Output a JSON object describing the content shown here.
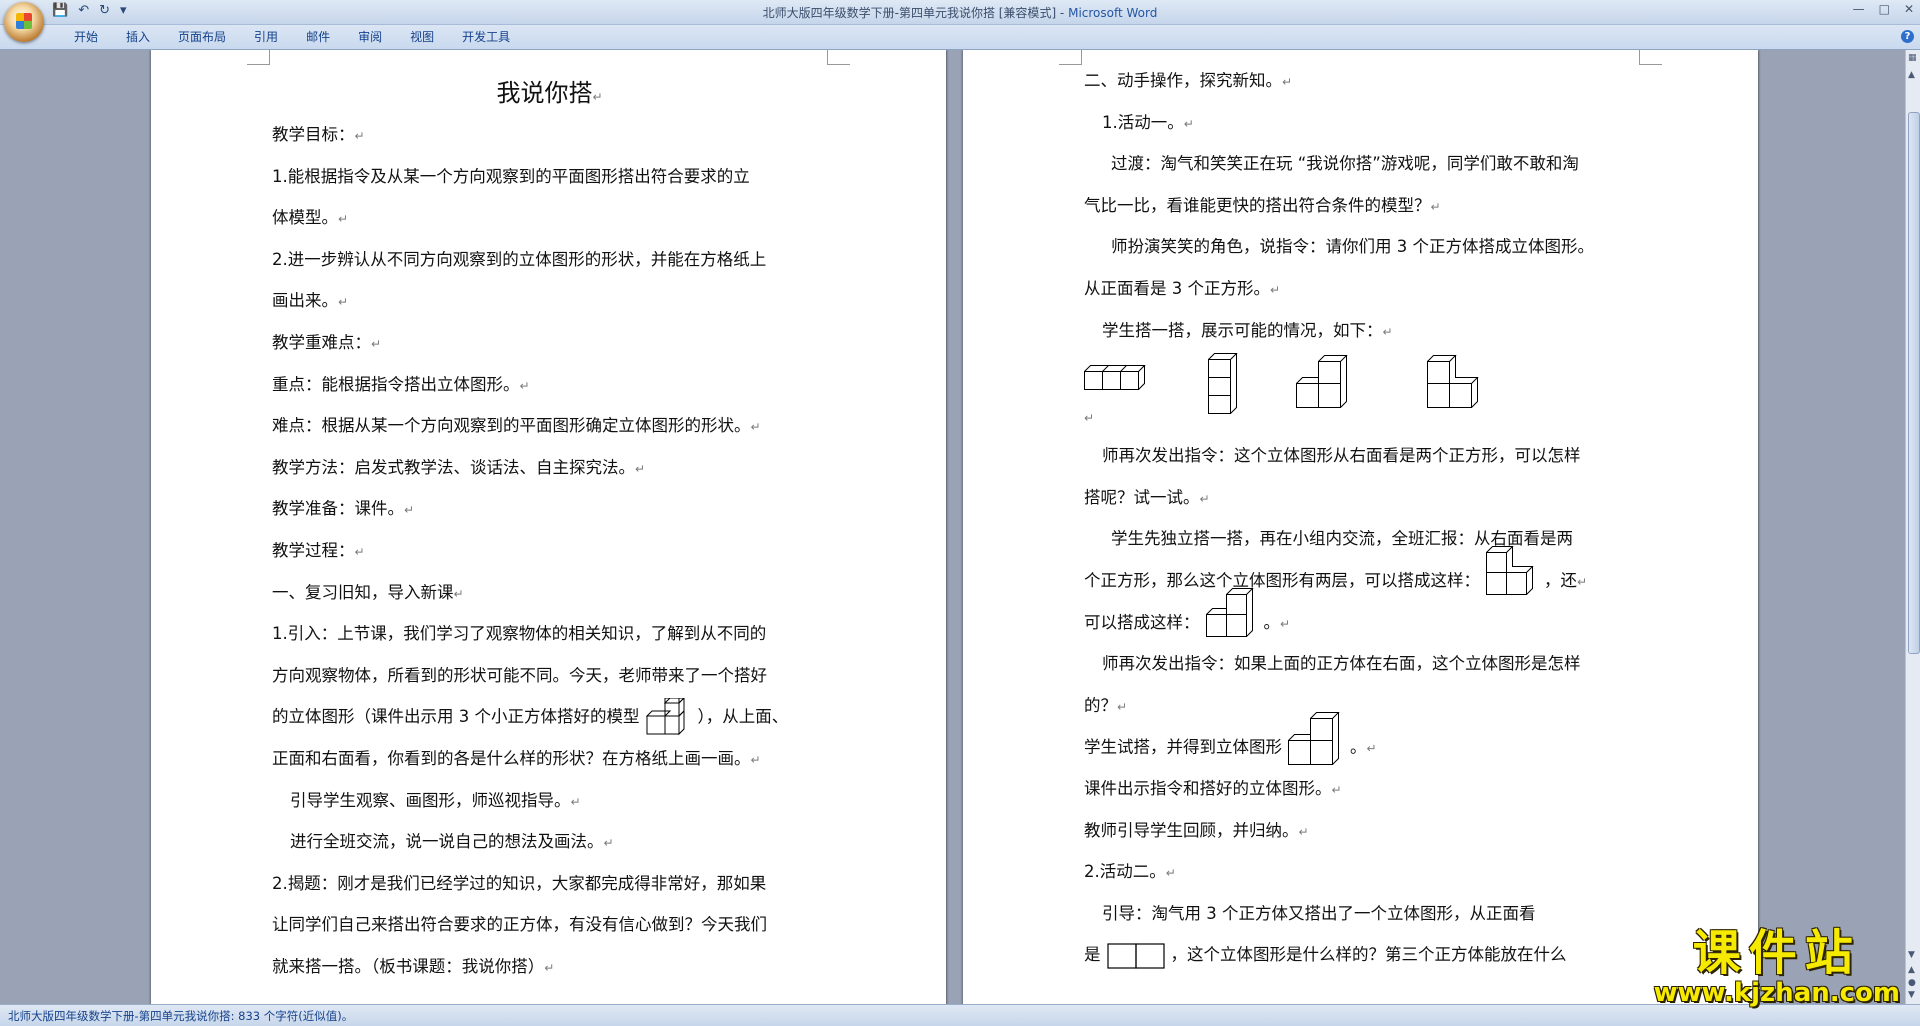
{
  "titlebar": {
    "doc_title": "北师大版四年级数学下册-第四单元我说你搭 [兼容模式] - ",
    "app_name": "Microsoft Word",
    "qat": {
      "save": "💾",
      "undo": "↶",
      "redo": "↻",
      "more": "▾"
    },
    "controls": {
      "minimize": "—",
      "maximize": "□",
      "close": "✕"
    }
  },
  "ribbon": {
    "tabs": [
      "开始",
      "插入",
      "页面布局",
      "引用",
      "邮件",
      "审阅",
      "视图",
      "开发工具"
    ],
    "help": "?"
  },
  "left_page": {
    "title": "我说你搭",
    "lines": [
      "教学目标：",
      "1.能根据指令及从某一个方向观察到的平面图形搭出符合要求的立",
      "体模型。",
      "2.进一步辨认从不同方向观察到的立体图形的形状，并能在方格纸上",
      "画出来。",
      "教学重难点：",
      "重点：能根据指令搭出立体图形。",
      "难点：根据从某一个方向观察到的平面图形确定立体图形的形状。",
      "教学方法：启发式教学法、谈话法、自主探究法。",
      "教学准备：课件。",
      "教学过程：",
      "一、复习旧知，导入新课",
      "1.引入：上节课，我们学习了观察物体的相关知识，了解到从不同的",
      "方向观察物体，所看到的形状可能不同。今天，老师带来了一个搭好"
    ],
    "model_line_a": "的立体图形（课件出示用 3 个小正方体搭好的模型",
    "model_line_b": "），从上面、",
    "lines2": [
      "正面和右面看，你看到的各是什么样的形状？在方格纸上画一画。",
      "引导学生观察、画图形，师巡视指导。",
      "进行全班交流，说一说自己的想法及画法。",
      "2.揭题：刚才是我们已经学过的知识，大家都完成得非常好，那如果",
      "让同学们自己来搭出符合要求的正方体，有没有信心做到？今天我们",
      "就来搭一搭。（板书课题：我说你搭）"
    ]
  },
  "right_page": {
    "lines": [
      "二、动手操作，探究新知。",
      "1.活动一。",
      "过渡：淘气和笑笑正在玩 “我说你搭”游戏呢，同学们敢不敢和淘",
      "气比一比，看谁能更快的搭出符合条件的模型？",
      "师扮演笑笑的角色，说指令：请你们用 3 个正方体搭成立体图形。",
      "从正面看是 3 个正方形。",
      "学生搭一搭，展示可能的情况，如下："
    ],
    "lines_b": [
      "师再次发出指令：这个立体图形从右面看是两个正方形，可以怎样",
      "搭呢？试一试。",
      "学生先独立搭一搭，再在小组内交流，全班汇报：从右面看是两"
    ],
    "line_c1": "个正方形，那么这个立体图形有两层，可以搭成这样：",
    "line_c2": "，还",
    "line_d1": "可以搭成这样：",
    "line_d2": "。",
    "lines_e": [
      "师再次发出指令：如果上面的正方体在右面，这个立体图形是怎样",
      "的？"
    ],
    "line_f1": "学生试搭，并得到立体图形",
    "line_f2": "。",
    "lines_g": [
      "课件出示指令和搭好的立体图形。",
      "教师引导学生回顾，并归纳。",
      "2.活动二。",
      "引导：淘气用 3 个正方体又搭出了一个立体图形，从正面看"
    ],
    "line_h1": "是",
    "line_h2": "，这个立体图形是什么样的？第三个正方体能放在什么"
  },
  "status_bar": {
    "text": "北师大版四年级数学下册-第四单元我说你搭: 833 个字符(近似值)。"
  },
  "watermark": {
    "cn": "课件站",
    "en": "www.kjzhan.com"
  },
  "para_mark": "↵"
}
